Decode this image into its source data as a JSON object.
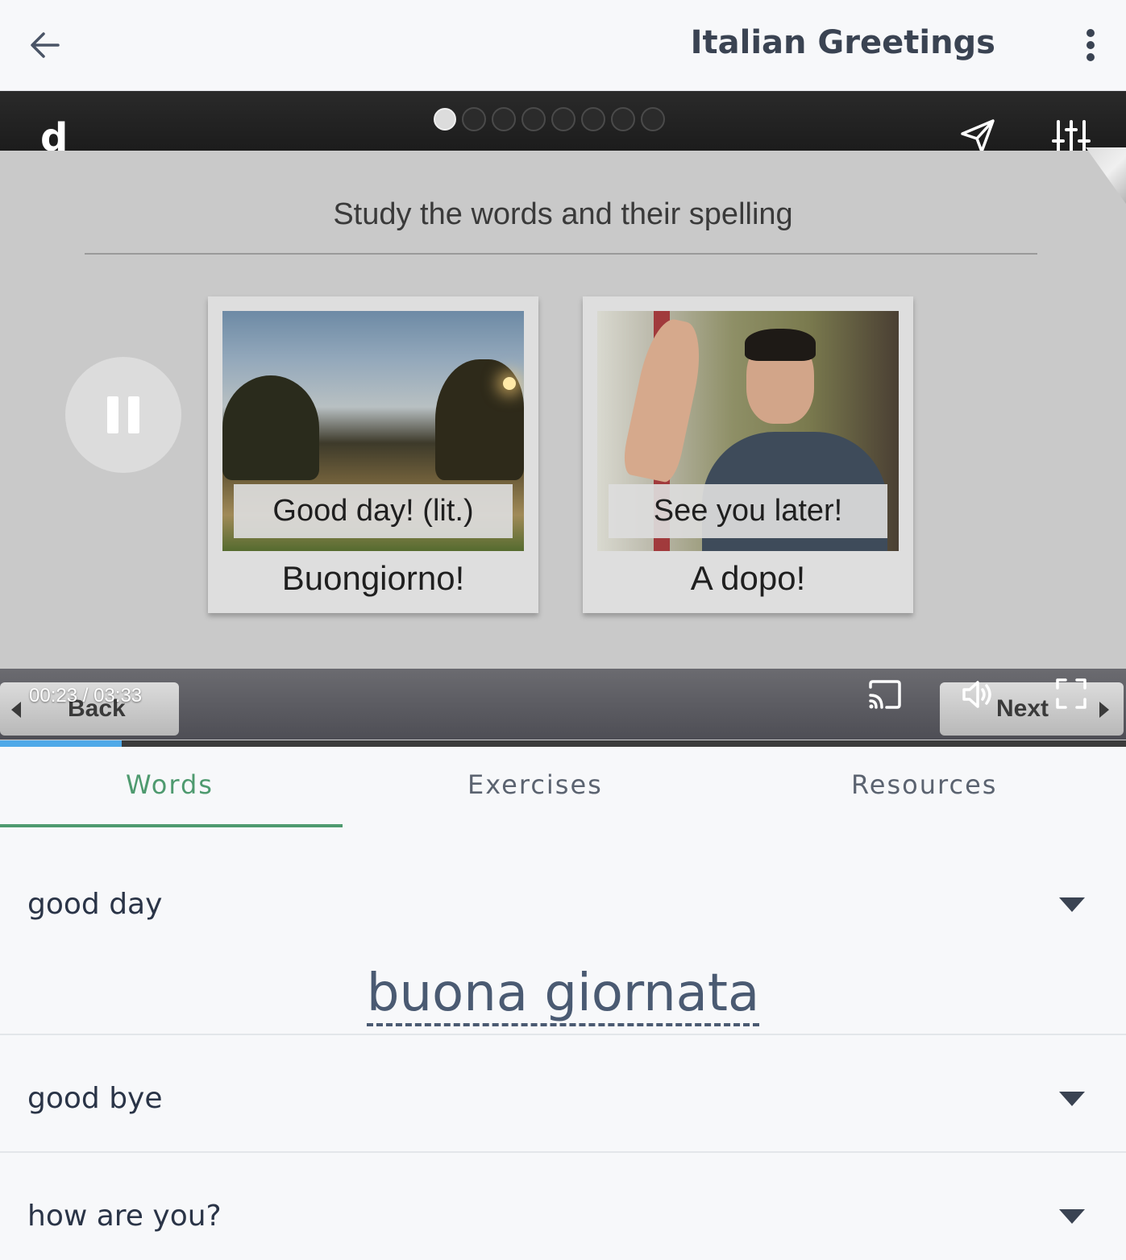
{
  "header": {
    "title": "Italian Greetings",
    "back_icon": "arrow-left-icon",
    "menu_icon": "more-vertical-icon"
  },
  "video": {
    "logo_text": "d",
    "slide_dots": 8,
    "active_dot": 1,
    "instruction": "Study the words and their spelling",
    "cards": [
      {
        "caption": "Good day! (lit.)",
        "word": "Buongiorno!"
      },
      {
        "caption": "See you later!",
        "word": "A dopo!"
      }
    ],
    "back_label": "Back",
    "next_label": "Next",
    "current_time": "00:23",
    "duration": "03:33",
    "time_separator": "/",
    "progress": 0.108,
    "colors": {
      "progress": "#4fa9e8"
    }
  },
  "tabs": {
    "items": [
      {
        "label": "Words",
        "active": true
      },
      {
        "label": "Exercises",
        "active": false
      },
      {
        "label": "Resources",
        "active": false
      }
    ],
    "accent": "#4e9a6f"
  },
  "words": [
    {
      "english": "good day",
      "translation": "buona giornata",
      "expanded": true
    },
    {
      "english": "good bye",
      "expanded": false
    },
    {
      "english": "how are you?",
      "expanded": false
    }
  ]
}
